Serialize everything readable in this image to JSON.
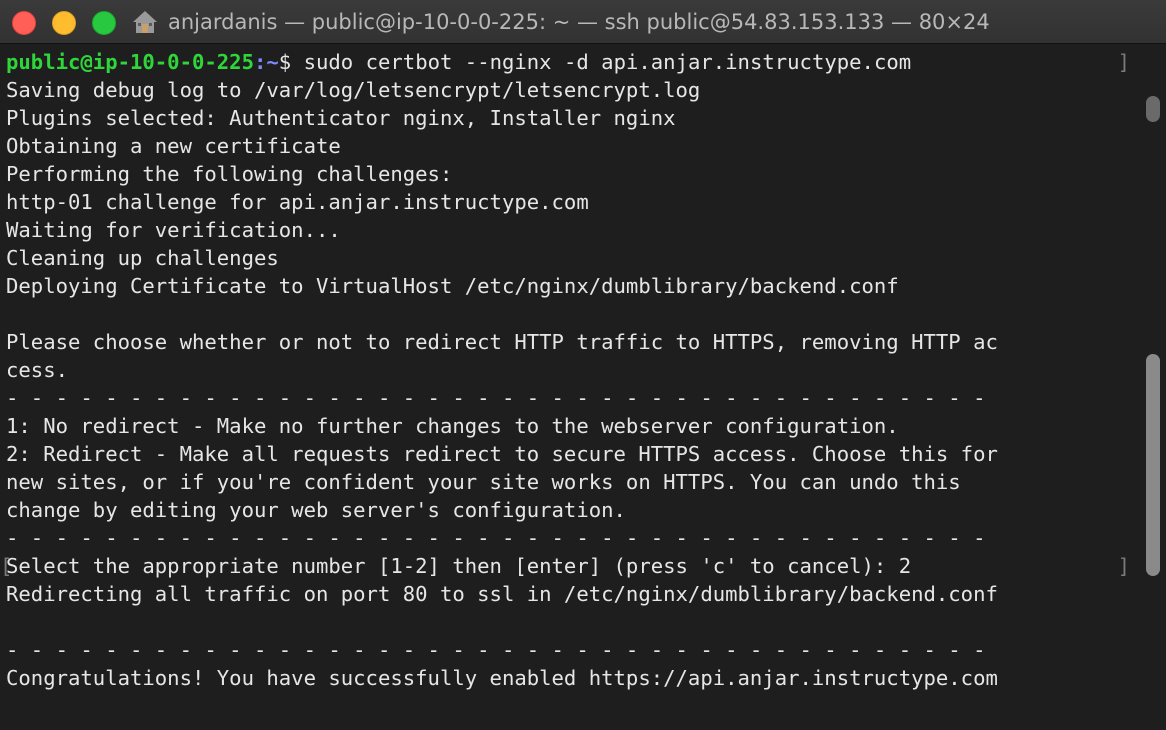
{
  "window": {
    "title": "anjardanis — public@ip-10-0-0-225: ~ — ssh public@54.83.153.133 — 80×24",
    "icon": "home-icon"
  },
  "terminal": {
    "prompt_user": "public@ip-10-0-0-225",
    "prompt_path": ":~",
    "prompt_symbol": "$ ",
    "command": "sudo certbot --nginx -d api.anjar.instructype.com",
    "lines": [
      "Saving debug log to /var/log/letsencrypt/letsencrypt.log",
      "Plugins selected: Authenticator nginx, Installer nginx",
      "Obtaining a new certificate",
      "Performing the following challenges:",
      "http-01 challenge for api.anjar.instructype.com",
      "Waiting for verification...",
      "Cleaning up challenges",
      "Deploying Certificate to VirtualHost /etc/nginx/dumblibrary/backend.conf",
      "",
      "Please choose whether or not to redirect HTTP traffic to HTTPS, removing HTTP ac",
      "cess.",
      "- - - - - - - - - - - - - - - - - - - - - - - - - - - - - - - - - - - - - - - -",
      "1: No redirect - Make no further changes to the webserver configuration.",
      "2: Redirect - Make all requests redirect to secure HTTPS access. Choose this for",
      "new sites, or if you're confident your site works on HTTPS. You can undo this",
      "change by editing your web server's configuration.",
      "- - - - - - - - - - - - - - - - - - - - - - - - - - - - - - - - - - - - - - - -",
      "Select the appropriate number [1-2] then [enter] (press 'c' to cancel): 2",
      "Redirecting all traffic on port 80 to ssl in /etc/nginx/dumblibrary/backend.conf",
      "",
      "- - - - - - - - - - - - - - - - - - - - - - - - - - - - - - - - - - - - - - - -",
      "Congratulations! You have successfully enabled https://api.anjar.instructype.com"
    ]
  },
  "colors": {
    "background": "#1e1e1e",
    "text": "#e6e6e6",
    "prompt_user": "#2fd63a",
    "prompt_path": "#7a8bff"
  }
}
